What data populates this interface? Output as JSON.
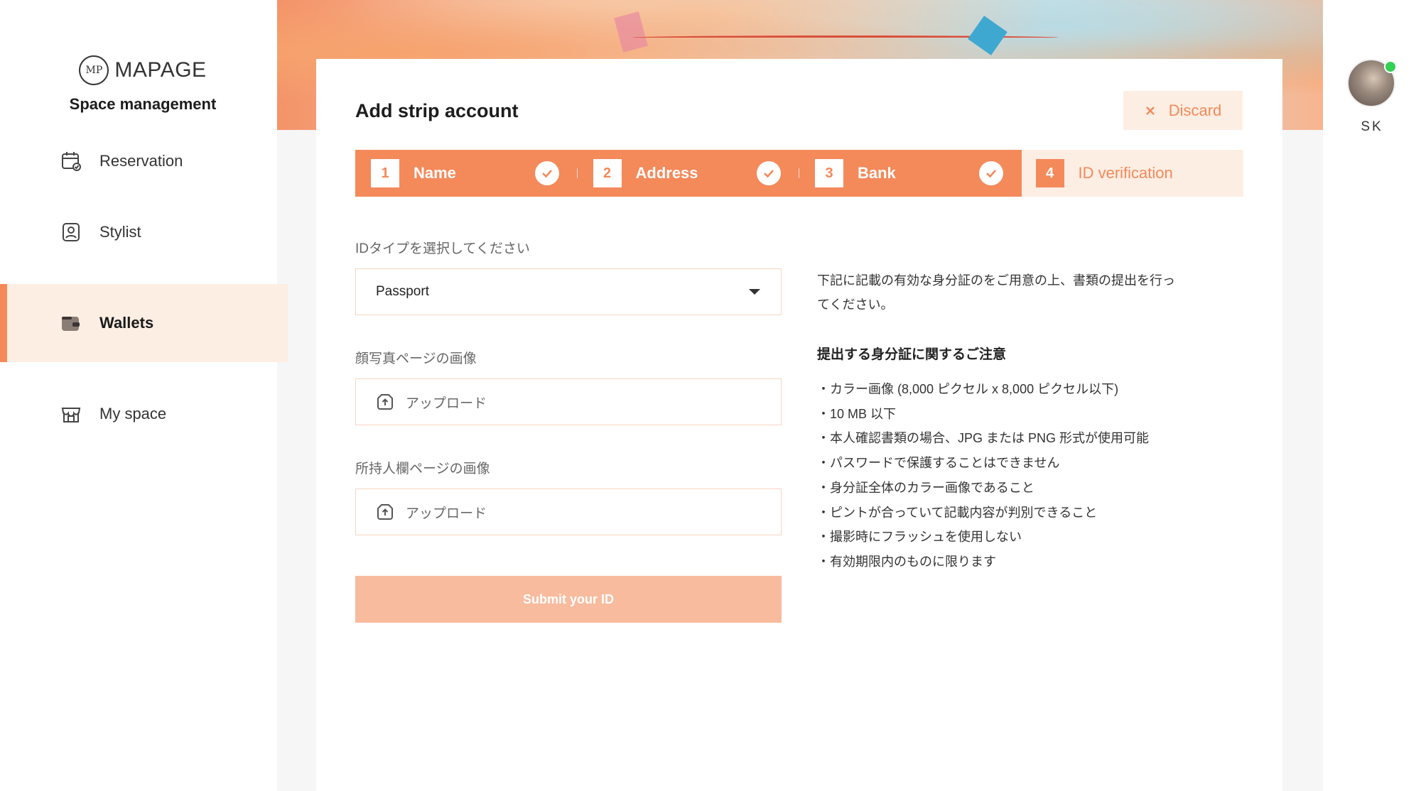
{
  "brand": {
    "logo_text": "MAPAGE",
    "logo_mark": "MP",
    "subtitle": "Space management"
  },
  "sidebar": {
    "items": [
      {
        "label": "Reservation",
        "icon": "calendar-icon",
        "active": false
      },
      {
        "label": "Stylist",
        "icon": "stylist-badge-icon",
        "active": false
      },
      {
        "label": "Wallets",
        "icon": "wallet-icon",
        "active": true
      },
      {
        "label": "My space",
        "icon": "store-icon",
        "active": false
      }
    ]
  },
  "card": {
    "title": "Add strip account",
    "discard_label": "Discard"
  },
  "stepper": {
    "steps": [
      {
        "number": "1",
        "label": "Name",
        "status": "done"
      },
      {
        "number": "2",
        "label": "Address",
        "status": "done"
      },
      {
        "number": "3",
        "label": "Bank",
        "status": "done"
      },
      {
        "number": "4",
        "label": "ID verification",
        "status": "current"
      }
    ]
  },
  "form": {
    "id_type_label": "IDタイプを選択してください",
    "id_type_value": "Passport",
    "photo_page_label": "顔写真ページの画像",
    "photo_page_upload": "アップロード",
    "holder_page_label": "所持人欄ページの画像",
    "holder_page_upload": "アップロード",
    "submit_label": "Submit your ID"
  },
  "info": {
    "intro": "下記に記載の有効な身分証のをご用意の上、書類の提出を行ってください。",
    "heading": "提出する身分証に関するご注意",
    "notes": [
      "カラー画像 (8,000 ピクセル x 8,000 ピクセル以下)",
      "10 MB 以下",
      "本人確認書類の場合、JPG または PNG 形式が使用可能",
      "パスワードで保護することはできません",
      "身分証全体のカラー画像であること",
      "ピントが合っていて記載内容が判別できること",
      "撮影時にフラッシュを使用しない",
      "有効期限内のものに限ります"
    ]
  },
  "user": {
    "initials": "SK",
    "online": true
  },
  "colors": {
    "accent": "#f4895a",
    "accent_light": "#fdeee3",
    "submit_disabled": "#f8bb9e",
    "online": "#33d154"
  }
}
